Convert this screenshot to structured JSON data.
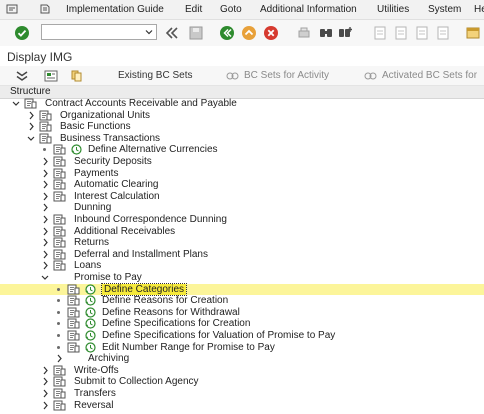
{
  "menu": {
    "items": [
      "Implementation Guide",
      "Edit",
      "Goto",
      "Additional Information",
      "Utilities",
      "System",
      "Help"
    ]
  },
  "toolbar": {
    "command_field_value": ""
  },
  "title": "Display IMG",
  "app_toolbar": {
    "existing_bc_sets": "Existing BC Sets",
    "bc_sets_for_activity": "BC Sets for Activity",
    "activated_bc_sets": "Activated BC Sets for"
  },
  "structure_header": "Structure",
  "tree": [
    {
      "label": "Contract Accounts Receivable and Payable",
      "level": 0,
      "expander": "open",
      "bullet": false,
      "book": true,
      "clock": false
    },
    {
      "label": "Organizational Units",
      "level": 1,
      "expander": "closed",
      "bullet": false,
      "book": true,
      "clock": false
    },
    {
      "label": "Basic Functions",
      "level": 1,
      "expander": "closed",
      "bullet": false,
      "book": true,
      "clock": false
    },
    {
      "label": "Business Transactions",
      "level": 1,
      "expander": "open",
      "bullet": false,
      "book": true,
      "clock": false
    },
    {
      "label": "Define Alternative Currencies",
      "level": 2,
      "expander": "none",
      "bullet": true,
      "book": true,
      "clock": true
    },
    {
      "label": "Security Deposits",
      "level": 2,
      "expander": "closed",
      "bullet": false,
      "book": true,
      "clock": false
    },
    {
      "label": "Payments",
      "level": 2,
      "expander": "closed",
      "bullet": false,
      "book": true,
      "clock": false
    },
    {
      "label": "Automatic Clearing",
      "level": 2,
      "expander": "closed",
      "bullet": false,
      "book": true,
      "clock": false
    },
    {
      "label": "Interest Calculation",
      "level": 2,
      "expander": "closed",
      "bullet": false,
      "book": true,
      "clock": false
    },
    {
      "label": "Dunning",
      "level": 2,
      "expander": "closed",
      "bullet": false,
      "book": false,
      "clock": false
    },
    {
      "label": "Inbound Correspondence Dunning",
      "level": 2,
      "expander": "closed",
      "bullet": false,
      "book": true,
      "clock": false
    },
    {
      "label": "Additional Receivables",
      "level": 2,
      "expander": "closed",
      "bullet": false,
      "book": true,
      "clock": false
    },
    {
      "label": "Returns",
      "level": 2,
      "expander": "closed",
      "bullet": false,
      "book": true,
      "clock": false
    },
    {
      "label": "Deferral and Installment Plans",
      "level": 2,
      "expander": "closed",
      "bullet": false,
      "book": true,
      "clock": false
    },
    {
      "label": "Loans",
      "level": 2,
      "expander": "closed",
      "bullet": false,
      "book": true,
      "clock": false
    },
    {
      "label": "Promise to Pay",
      "level": 2,
      "expander": "open",
      "bullet": false,
      "book": false,
      "clock": false
    },
    {
      "label": "Define Categories",
      "level": 3,
      "expander": "none",
      "bullet": true,
      "book": true,
      "clock": true,
      "selected": true
    },
    {
      "label": "Define Reasons for Creation",
      "level": 3,
      "expander": "none",
      "bullet": true,
      "book": true,
      "clock": true
    },
    {
      "label": "Define Reasons for Withdrawal",
      "level": 3,
      "expander": "none",
      "bullet": true,
      "book": true,
      "clock": true
    },
    {
      "label": "Define Specifications for Creation",
      "level": 3,
      "expander": "none",
      "bullet": true,
      "book": true,
      "clock": true
    },
    {
      "label": "Define Specifications for Valuation of Promise to Pay",
      "level": 3,
      "expander": "none",
      "bullet": true,
      "book": true,
      "clock": true
    },
    {
      "label": "Edit Number Range for Promise to Pay",
      "level": 3,
      "expander": "none",
      "bullet": true,
      "book": true,
      "clock": true
    },
    {
      "label": "Archiving",
      "level": 3,
      "expander": "closed",
      "bullet": false,
      "book": false,
      "clock": false
    },
    {
      "label": "Write-Offs",
      "level": 2,
      "expander": "closed",
      "bullet": false,
      "book": true,
      "clock": false
    },
    {
      "label": "Submit to Collection Agency",
      "level": 2,
      "expander": "closed",
      "bullet": false,
      "book": true,
      "clock": false
    },
    {
      "label": "Transfers",
      "level": 2,
      "expander": "closed",
      "bullet": false,
      "book": true,
      "clock": false
    },
    {
      "label": "Reversal",
      "level": 2,
      "expander": "closed",
      "bullet": false,
      "book": true,
      "clock": false
    }
  ],
  "colors": {
    "selection": "#fcf59a",
    "green_check": "#2e8b2e",
    "accent_orange": "#e8a13a",
    "cancel_red": "#d63a2f"
  }
}
